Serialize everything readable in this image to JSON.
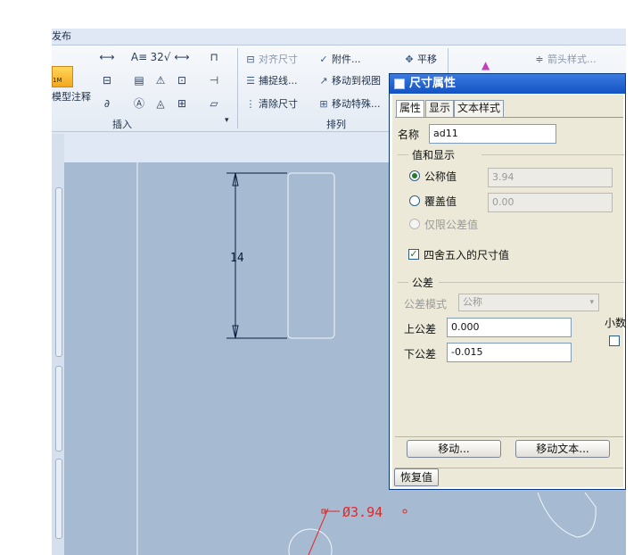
{
  "ribbon": {
    "tab_label": "发布",
    "annotate_label": "模型注释",
    "annotate_icon_text": "1M",
    "group_insert": "插入",
    "group_arrange": "排列",
    "tools": {
      "align_dim": "对齐尺寸",
      "attach": "附件...",
      "pan": "平移",
      "arrow_style": "箭头样式...",
      "capture_line": "捕捉线...",
      "move_to_view": "移动到视图",
      "clear_dim": "清除尺寸",
      "move_special": "移动特殊..."
    },
    "insert_icons": [
      "⟷",
      "A≡",
      "32√",
      "⟷",
      "⊓",
      "⊟",
      "▤",
      "⚠",
      "⊡",
      "⊣",
      "∂",
      "Ⓐ",
      "◬",
      "⊞",
      "▱"
    ]
  },
  "drawing": {
    "dim_text": "14",
    "diameter_text": "Ø3.94",
    "line_color": "#0b1e3d",
    "annot_color": "#e22626",
    "canvas_color": "#a6bbd2"
  },
  "dialog": {
    "title": "尺寸属性",
    "tabs": [
      "属性",
      "显示",
      "文本样式"
    ],
    "name_label": "名称",
    "name_value": "ad11",
    "value_group": "值和显示",
    "nominal_label": "公称值",
    "nominal_value": "3.94",
    "override_label": "覆盖值",
    "override_value": "0.00",
    "tol_only_label": "仅限公差值",
    "round_label": "四舍五入的尺寸值",
    "round_checked": true,
    "tol_group": "公差",
    "tol_mode_label": "公差模式",
    "tol_mode_value": "公称",
    "upper_label": "上公差",
    "upper_value": "0.000",
    "lower_label": "下公差",
    "lower_value": "-0.015",
    "decimal_label": "小数",
    "move_btn": "移动...",
    "move_text_btn": "移动文本...",
    "restore_btn": "恢复值"
  }
}
